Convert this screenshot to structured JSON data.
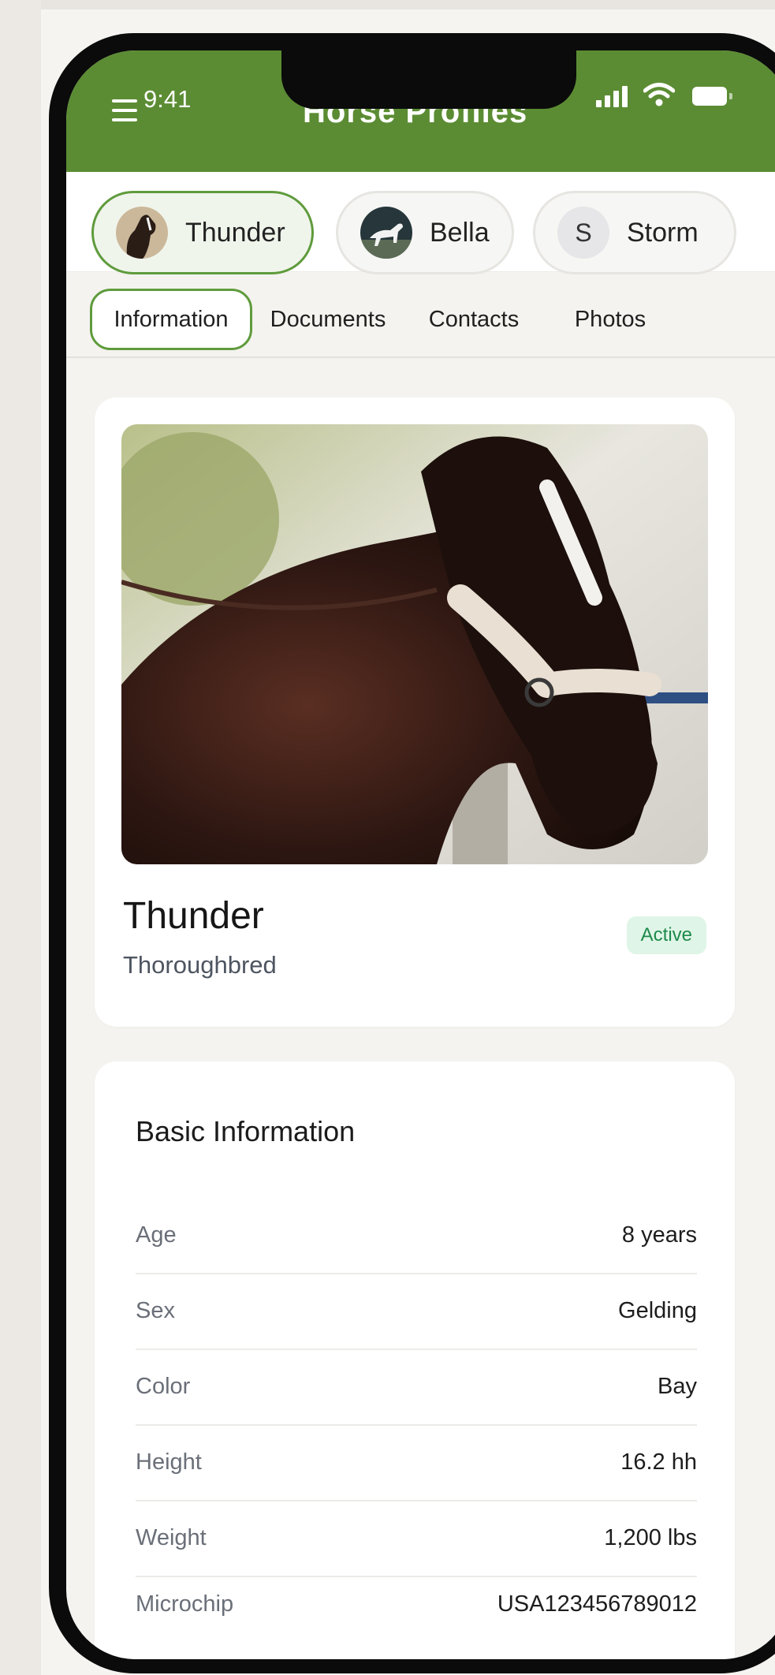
{
  "status_bar": {
    "time": "9:41"
  },
  "header": {
    "title": "Horse Profiles"
  },
  "horses": [
    {
      "name": "Thunder",
      "avatar": "horse-photo-dark"
    },
    {
      "name": "Bella",
      "avatar": "horse-photo-white"
    },
    {
      "name": "Storm",
      "avatar_letter": "S"
    }
  ],
  "tabs": [
    "Information",
    "Documents",
    "Contacts",
    "Photos"
  ],
  "active_tab": "Information",
  "profile": {
    "name": "Thunder",
    "breed": "Thoroughbred",
    "status": "Active"
  },
  "basic_info": {
    "title": "Basic Information",
    "rows": [
      {
        "label": "Age",
        "value": "8 years"
      },
      {
        "label": "Sex",
        "value": "Gelding"
      },
      {
        "label": "Color",
        "value": "Bay"
      },
      {
        "label": "Height",
        "value": "16.2 hh"
      },
      {
        "label": "Weight",
        "value": "1,200 lbs"
      },
      {
        "label": "Microchip",
        "value": "USA123456789012"
      }
    ]
  },
  "colors": {
    "header": "#5b8c33",
    "accent": "#5f9b3c",
    "badge_bg": "#dff5e7",
    "badge_text": "#1e8a4c"
  }
}
